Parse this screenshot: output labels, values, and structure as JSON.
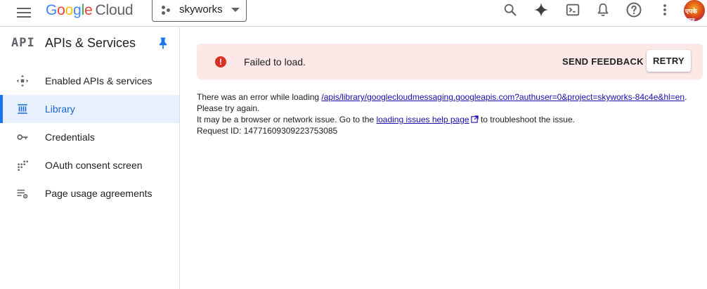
{
  "topbar": {
    "menu_icon": "hamburger-menu-icon",
    "logo_letters": [
      "G",
      "o",
      "o",
      "g",
      "l",
      "e"
    ],
    "logo_product": "Cloud",
    "project": "skyworks",
    "icons": [
      "search-icon",
      "gemini-spark-icon",
      "cloud-shell-icon",
      "notifications-icon",
      "help-icon",
      "more-vert-icon"
    ],
    "avatar_text": "एपके सात"
  },
  "sidebar": {
    "api_mark": "API",
    "title": "APIs & Services",
    "items": [
      {
        "label": "Enabled APIs & services",
        "icon": "enabled-apis-icon",
        "active": false
      },
      {
        "label": "Library",
        "icon": "library-icon",
        "active": true
      },
      {
        "label": "Credentials",
        "icon": "key-icon",
        "active": false
      },
      {
        "label": "OAuth consent screen",
        "icon": "oauth-consent-icon",
        "active": false
      },
      {
        "label": "Page usage agreements",
        "icon": "page-usage-icon",
        "active": false
      }
    ]
  },
  "colors": {
    "accent": "#1a73e8",
    "active_bg": "#e8f0fe",
    "error_banner_bg": "#fce8e6",
    "error_red": "#d93025"
  },
  "error": {
    "message": "Failed to load.",
    "send_feedback": "SEND FEEDBACK",
    "retry": "RETRY",
    "line1_prefix": "There was an error while loading ",
    "line1_link": "/apis/library/googlecloudmessaging.googleapis.com?authuser=0&project=skyworks-84c4e&hl=en",
    "line1_suffix": ".",
    "line2": "Please try again.",
    "line3_prefix": "It may be a browser or network issue. Go to the ",
    "line3_link": "loading issues help page",
    "line3_suffix": " to troubleshoot the issue.",
    "request_id": "Request ID: 14771609309223753085"
  }
}
